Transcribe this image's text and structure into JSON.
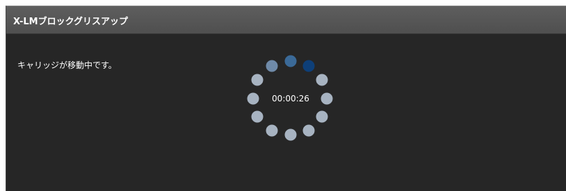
{
  "window": {
    "title": "X-LMブロックグリスアップ"
  },
  "message": {
    "status": "キャリッジが移動中です。"
  },
  "progress": {
    "elapsed_time": "00:00:26",
    "indicator": "busy-spinner",
    "dot_count": 12,
    "active_dot_index": 1
  },
  "colors": {
    "background": "#262626",
    "title_bar": "#595959",
    "dot_idle": "#a7b3c1",
    "dot_mid": "#6f8aa8",
    "dot_trail": "#3b6a98",
    "dot_active": "#0e3f78",
    "text": "#ffffff"
  }
}
